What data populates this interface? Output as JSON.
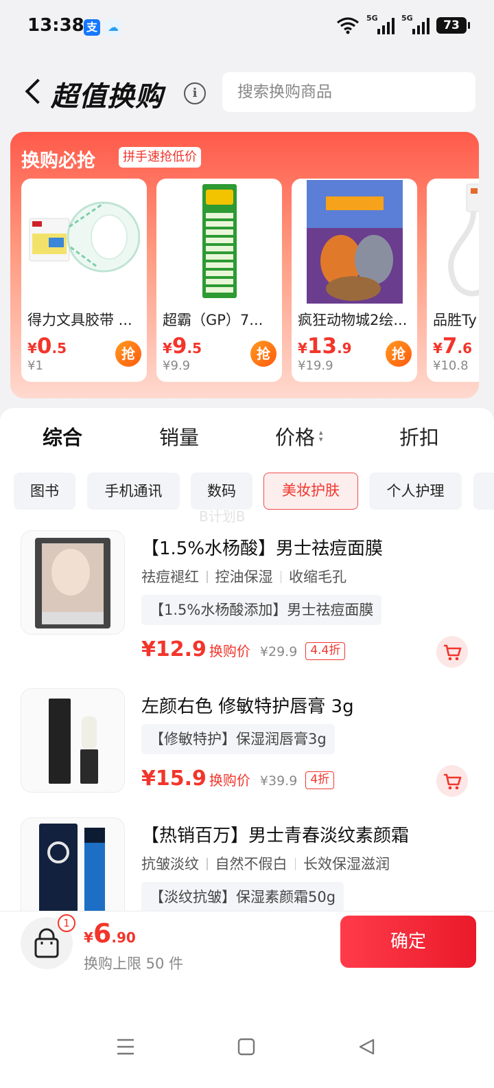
{
  "status_bar": {
    "time": "13:38",
    "signal1": "5G",
    "signal2": "5G",
    "battery": "73"
  },
  "header": {
    "title": "超值换购",
    "search_placeholder": "搜索换购商品"
  },
  "promo": {
    "title": "换购必抢",
    "tag": "拼手速抢低价",
    "grab_label": "抢",
    "cards": [
      {
        "name": "得力文具胶带 ...",
        "price_int": "0",
        "price_dec": ".5",
        "orig": "¥1"
      },
      {
        "name": "超霸（GP）7...",
        "price_int": "9",
        "price_dec": ".5",
        "orig": "¥9.9"
      },
      {
        "name": "疯狂动物城2绘...",
        "price_int": "13",
        "price_dec": ".9",
        "orig": "¥19.9"
      },
      {
        "name": "品胜Ty",
        "price_int": "7",
        "price_dec": ".6",
        "orig": "¥10.8"
      }
    ]
  },
  "sort_tabs": [
    "综合",
    "销量",
    "价格",
    "折扣"
  ],
  "categories": [
    "图书",
    "手机通讯",
    "数码",
    "美妆护肤",
    "个人护理"
  ],
  "selected_category": "美妆护肤",
  "watermark": "B计划B",
  "products": [
    {
      "name": "【1.5%水杨酸】男士祛痘面膜",
      "features": [
        "祛痘褪红",
        "控油保湿",
        "收缩毛孔"
      ],
      "desc": "【1.5%水杨酸添加】男士祛痘面膜",
      "price": "¥12.9",
      "price_label": "换购价",
      "orig": "¥29.9",
      "discount": "4.4折"
    },
    {
      "name": "左颜右色 修敏特护唇膏 3g",
      "desc": "【修敏特护】保湿润唇膏3g",
      "price": "¥15.9",
      "price_label": "换购价",
      "orig": "¥39.9",
      "discount": "4折"
    },
    {
      "name": "【热销百万】男士青春淡纹素颜霜",
      "features": [
        "抗皱淡纹",
        "自然不假白",
        "长效保湿滋润"
      ],
      "desc": "【淡纹抗皱】保湿素颜霜50g"
    }
  ],
  "bottom": {
    "badge": "1",
    "currency": "¥",
    "total_int": "6",
    "total_dec": ".90",
    "limit": "换购上限 50 件",
    "confirm": "确定"
  },
  "colors": {
    "accent": "#f2352b",
    "promo_top": "#ff5a4a",
    "confirm": "#ea1a2a"
  }
}
